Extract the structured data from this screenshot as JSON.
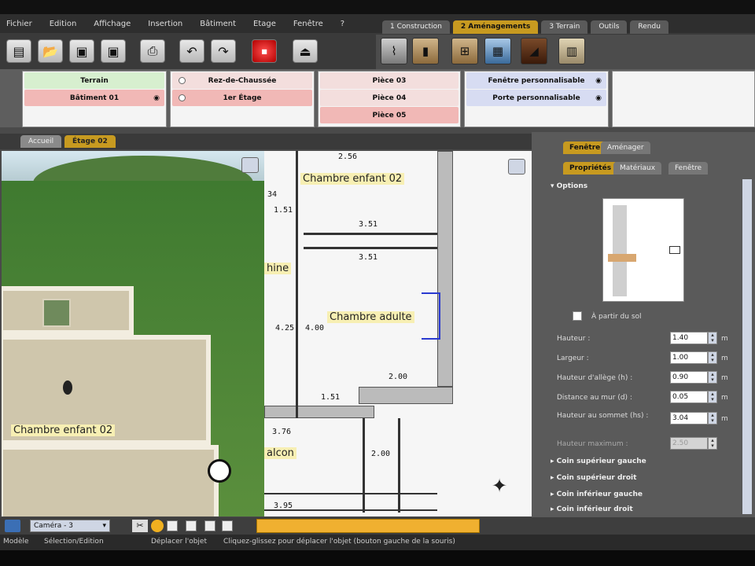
{
  "menu": [
    "Fichier",
    "Edition",
    "Affichage",
    "Insertion",
    "Bâtiment",
    "Etage",
    "Fenêtre",
    "?"
  ],
  "mode_tabs": [
    {
      "label": "1 Construction",
      "active": false
    },
    {
      "label": "2 Aménagements",
      "active": true
    },
    {
      "label": "3 Terrain",
      "active": false
    },
    {
      "label": "Outils",
      "active": false
    },
    {
      "label": "Rendu",
      "active": false
    }
  ],
  "lists": {
    "terrain": [
      {
        "label": "Terrain",
        "style": "green"
      },
      {
        "label": "Bâtiment 01",
        "style": "pink"
      }
    ],
    "etages": [
      {
        "label": "Rez-de-Chaussée",
        "style": "light"
      },
      {
        "label": "1er Étage",
        "style": "pink"
      }
    ],
    "pieces": [
      {
        "label": "Pièce 03",
        "style": "light"
      },
      {
        "label": "Pièce 04",
        "style": "light"
      },
      {
        "label": "Pièce 05",
        "style": "pink"
      }
    ],
    "elements": [
      {
        "label": "Fenêtre personnalisable",
        "style": "blue"
      },
      {
        "label": "Porte personnalisable",
        "style": "blue"
      }
    ]
  },
  "view_tabs": [
    "Accueil",
    "Étage 02"
  ],
  "view3d": {
    "label": "Chambre enfant 02"
  },
  "plan": {
    "room_labels": [
      "Chambre enfant 02",
      "Chambre adulte",
      "hine",
      "alcon"
    ],
    "dims": [
      "2.56",
      "34",
      "1.51",
      "3.51",
      "3.51",
      "4.25",
      "4.00",
      "2.00",
      "1.51",
      "3.76",
      "3.95",
      "2.00"
    ]
  },
  "props": {
    "tabs": [
      "Fenêtre",
      "Aménager"
    ],
    "subtabs": [
      "Propriétés",
      "Matériaux",
      "Fenêtre"
    ],
    "options_label": "Options",
    "checkbox_label": "À partir du sol",
    "fields": [
      {
        "label": "Hauteur :",
        "value": "1.40",
        "unit": "m"
      },
      {
        "label": "Largeur :",
        "value": "1.00",
        "unit": "m"
      },
      {
        "label": "Hauteur d'allège (h) :",
        "value": "0.90",
        "unit": "m"
      },
      {
        "label": "Distance au mur (d) :",
        "value": "0.05",
        "unit": "m"
      },
      {
        "label": "Hauteur au sommet (hs) :",
        "value": "3.04",
        "unit": "m"
      }
    ],
    "max_label": "Hauteur maximum :",
    "max_value": "2.50",
    "corners": [
      "Coin supérieur gauche",
      "Coin supérieur droit",
      "Coin inférieur gauche",
      "Coin inférieur droit"
    ]
  },
  "bottom": {
    "camera": "Caméra - 3"
  },
  "status": {
    "mode": "Modèle",
    "selection": "Sélection/Edition",
    "action": "Déplacer l'objet",
    "hint": "Cliquez-glissez pour déplacer l'objet (bouton gauche de la souris)"
  },
  "colors": {
    "accent": "#c79a20",
    "pink": "#f1b8b6",
    "green": "#d7efcf"
  }
}
